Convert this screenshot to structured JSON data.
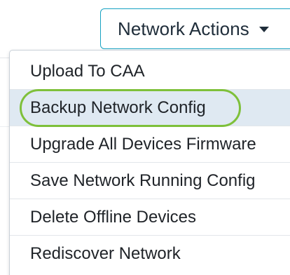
{
  "toolbar": {
    "network_actions_label": "Network Actions",
    "caret_icon": "caret-down-icon"
  },
  "menu": {
    "items": [
      {
        "label": "Upload To CAA"
      },
      {
        "label": "Backup Network Config",
        "selected": true
      },
      {
        "label": "Upgrade All Devices Firmware"
      },
      {
        "label": "Save Network Running Config"
      },
      {
        "label": "Delete Offline Devices"
      },
      {
        "label": "Rediscover Network"
      }
    ]
  },
  "colors": {
    "button_border": "#17a2c2",
    "selected_row": "#dfe9f2",
    "highlight_ring": "#7ec03a"
  }
}
